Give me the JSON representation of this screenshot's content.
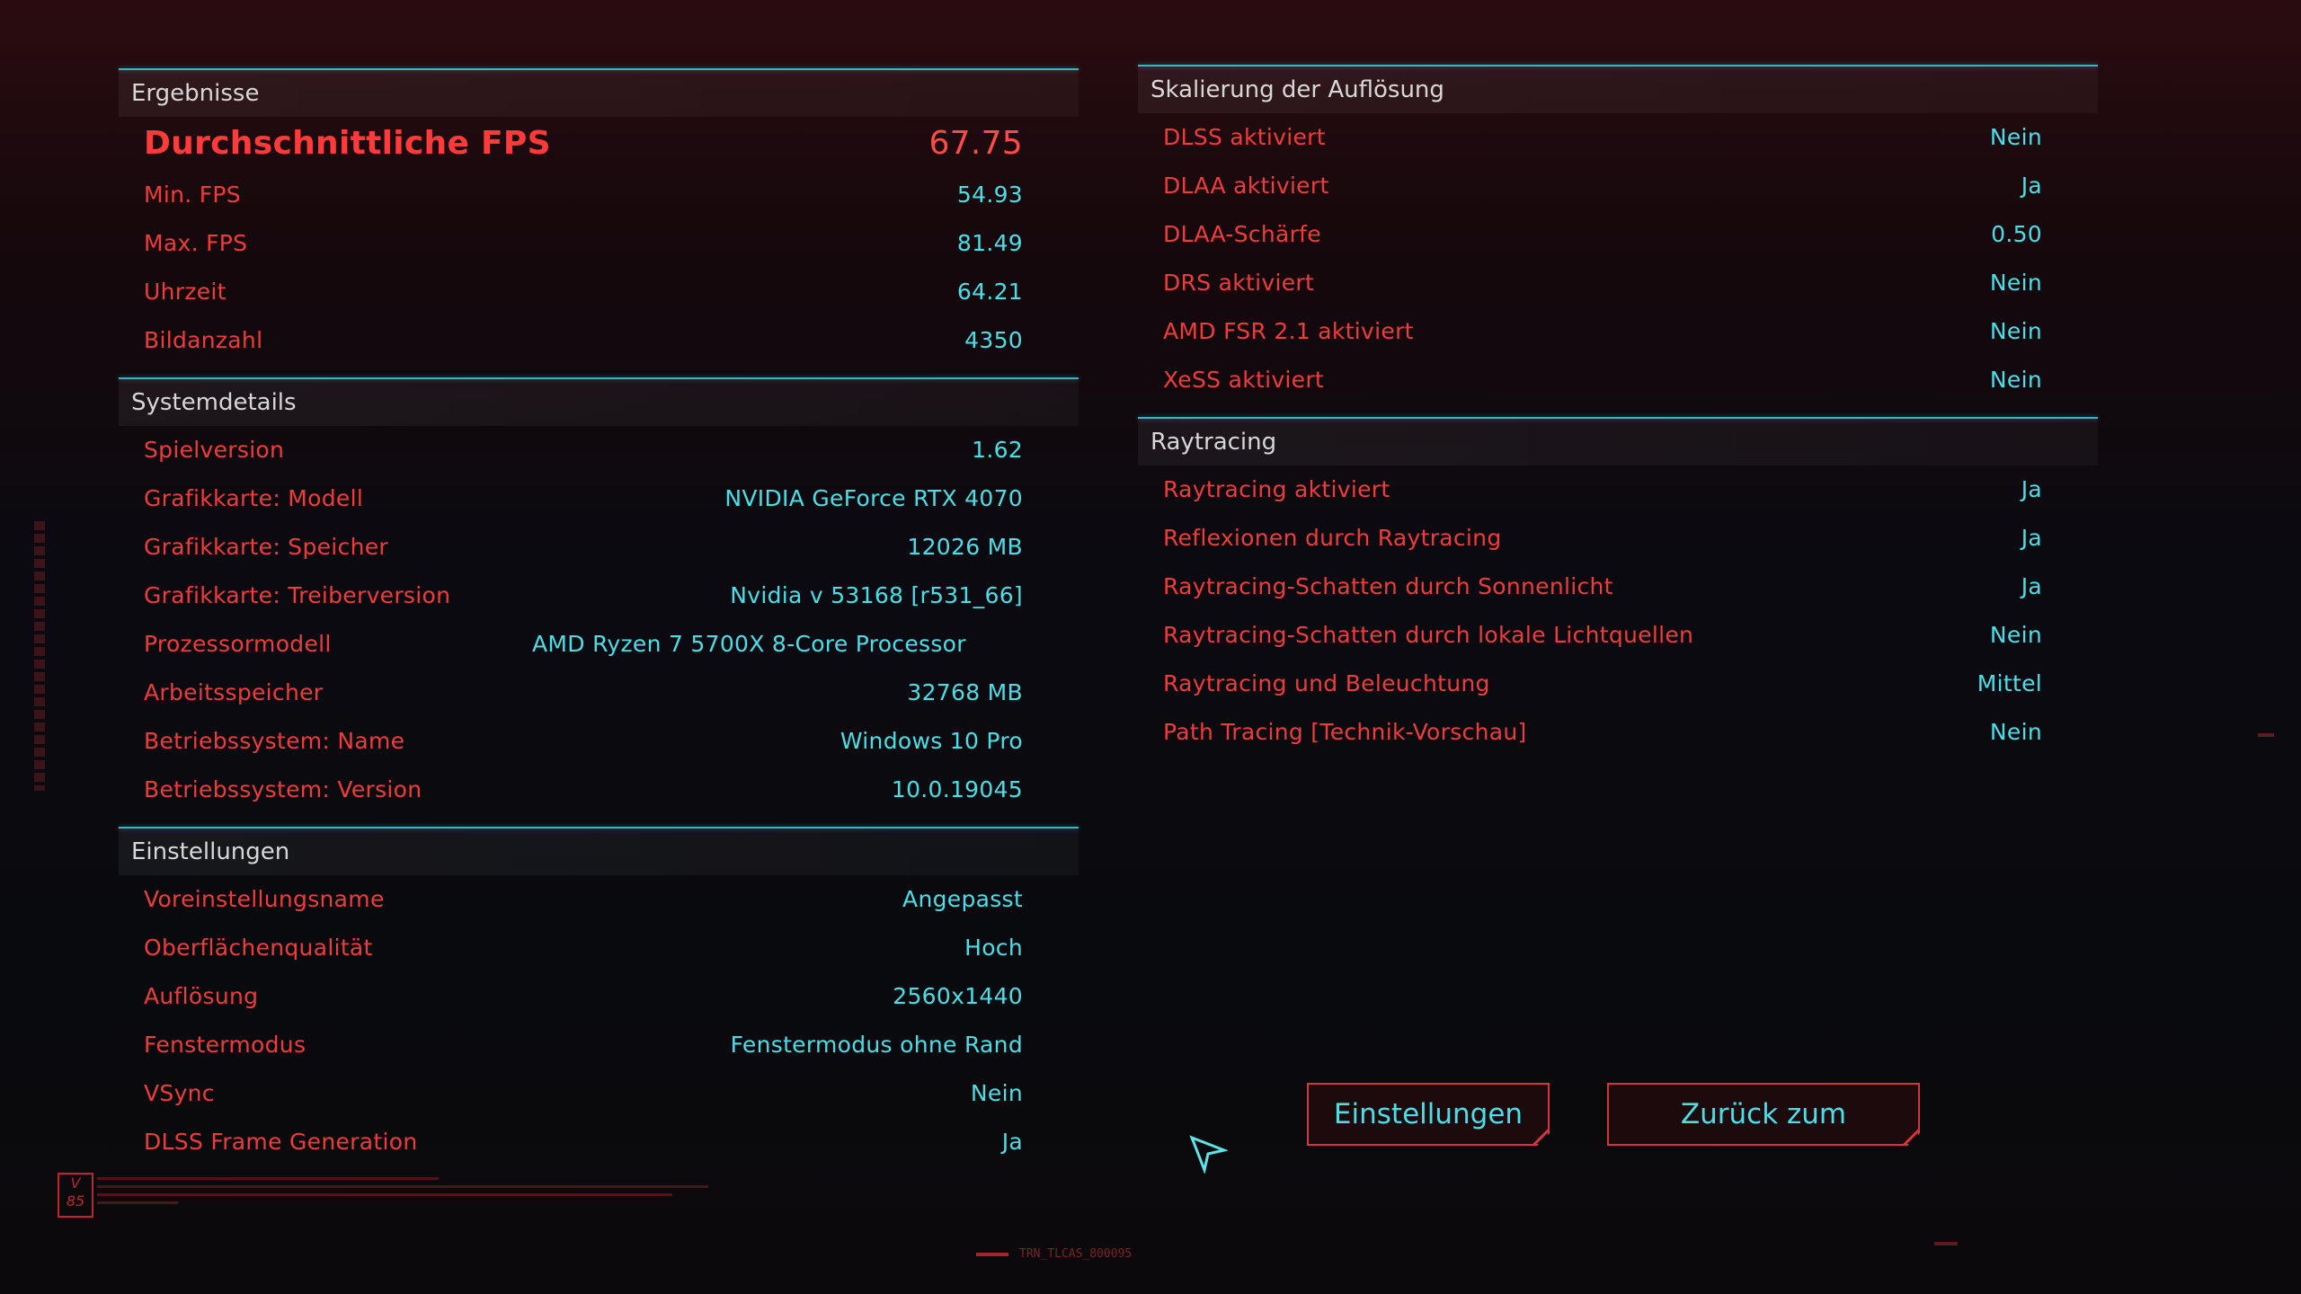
{
  "results": {
    "title": "Ergebnisse",
    "rows": [
      {
        "label": "Durchschnittliche FPS",
        "value": "67.75"
      },
      {
        "label": "Min. FPS",
        "value": "54.93"
      },
      {
        "label": "Max. FPS",
        "value": "81.49"
      },
      {
        "label": "Uhrzeit",
        "value": "64.21"
      },
      {
        "label": "Bildanzahl",
        "value": "4350"
      }
    ]
  },
  "system": {
    "title": "Systemdetails",
    "rows": [
      {
        "label": "Spielversion",
        "value": "1.62"
      },
      {
        "label": "Grafikkarte: Modell",
        "value": "NVIDIA GeForce RTX 4070"
      },
      {
        "label": "Grafikkarte: Speicher",
        "value": "12026 MB"
      },
      {
        "label": "Grafikkarte: Treiberversion",
        "value": "Nvidia v 53168 [r531_66]"
      },
      {
        "label": "Prozessormodell",
        "value": "AMD Ryzen 7 5700X 8-Core Processor"
      },
      {
        "label": "Arbeitsspeicher",
        "value": "32768 MB"
      },
      {
        "label": "Betriebssystem: Name",
        "value": "Windows 10 Pro"
      },
      {
        "label": "Betriebssystem: Version",
        "value": "10.0.19045"
      }
    ]
  },
  "settings": {
    "title": "Einstellungen",
    "rows": [
      {
        "label": "Voreinstellungsname",
        "value": "Angepasst"
      },
      {
        "label": "Oberflächenqualität",
        "value": "Hoch"
      },
      {
        "label": "Auflösung",
        "value": "2560x1440"
      },
      {
        "label": "Fenstermodus",
        "value": "Fenstermodus ohne Rand"
      },
      {
        "label": "VSync",
        "value": "Nein"
      },
      {
        "label": "DLSS Frame Generation",
        "value": "Ja"
      }
    ]
  },
  "scaling": {
    "title": "Skalierung der Auflösung",
    "rows": [
      {
        "label": "DLSS aktiviert",
        "value": "Nein"
      },
      {
        "label": "DLAA aktiviert",
        "value": "Ja"
      },
      {
        "label": "DLAA-Schärfe",
        "value": "0.50"
      },
      {
        "label": "DRS aktiviert",
        "value": "Nein"
      },
      {
        "label": "AMD FSR 2.1 aktiviert",
        "value": "Nein"
      },
      {
        "label": "XeSS aktiviert",
        "value": "Nein"
      }
    ]
  },
  "raytracing": {
    "title": "Raytracing",
    "rows": [
      {
        "label": "Raytracing aktiviert",
        "value": "Ja"
      },
      {
        "label": "Reflexionen durch Raytracing",
        "value": "Ja"
      },
      {
        "label": "Raytracing-Schatten durch Sonnenlicht",
        "value": "Ja"
      },
      {
        "label": "Raytracing-Schatten durch lokale Lichtquellen",
        "value": "Nein"
      },
      {
        "label": "Raytracing und Beleuchtung",
        "value": "Mittel"
      },
      {
        "label": "Path Tracing [Technik-Vorschau]",
        "value": "Nein"
      }
    ]
  },
  "buttons": {
    "settings": "Einstellungen",
    "main_menu": "Zurück zum Hauptmenü"
  },
  "footer": {
    "logo": "V 85",
    "tag": "TRN_TLCAS_800095"
  },
  "colors": {
    "label": "#ef3b3b",
    "value": "#48dfe8",
    "accent_line": "#35b8c4",
    "button_border": "#d9333b"
  }
}
